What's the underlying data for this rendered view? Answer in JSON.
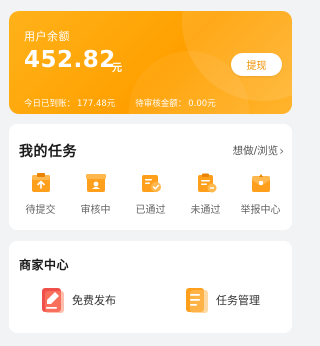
{
  "balance": {
    "title": "用户余额",
    "amount": "452.82",
    "unit": "元",
    "withdraw_label": "提现",
    "today_label": "今日已到账：",
    "today_value": "177.48元",
    "pending_label": "待审核金额：",
    "pending_value": "0.00元"
  },
  "tasks": {
    "title": "我的任务",
    "link_label": "想做/浏览",
    "items": [
      {
        "label": "待提交",
        "icon": "pending-submit-icon"
      },
      {
        "label": "审核中",
        "icon": "reviewing-icon"
      },
      {
        "label": "已通过",
        "icon": "approved-icon"
      },
      {
        "label": "未通过",
        "icon": "rejected-icon"
      },
      {
        "label": "举报中心",
        "icon": "report-center-icon"
      }
    ]
  },
  "merchant": {
    "title": "商家中心",
    "items": [
      {
        "label": "免费发布",
        "icon": "publish-icon"
      },
      {
        "label": "任务管理",
        "icon": "task-manage-icon"
      }
    ]
  },
  "colors": {
    "accent": "#ffa000",
    "icon_orange": "#ff9f1c",
    "icon_red": "#f0504a",
    "background": "#f2f3f5"
  }
}
